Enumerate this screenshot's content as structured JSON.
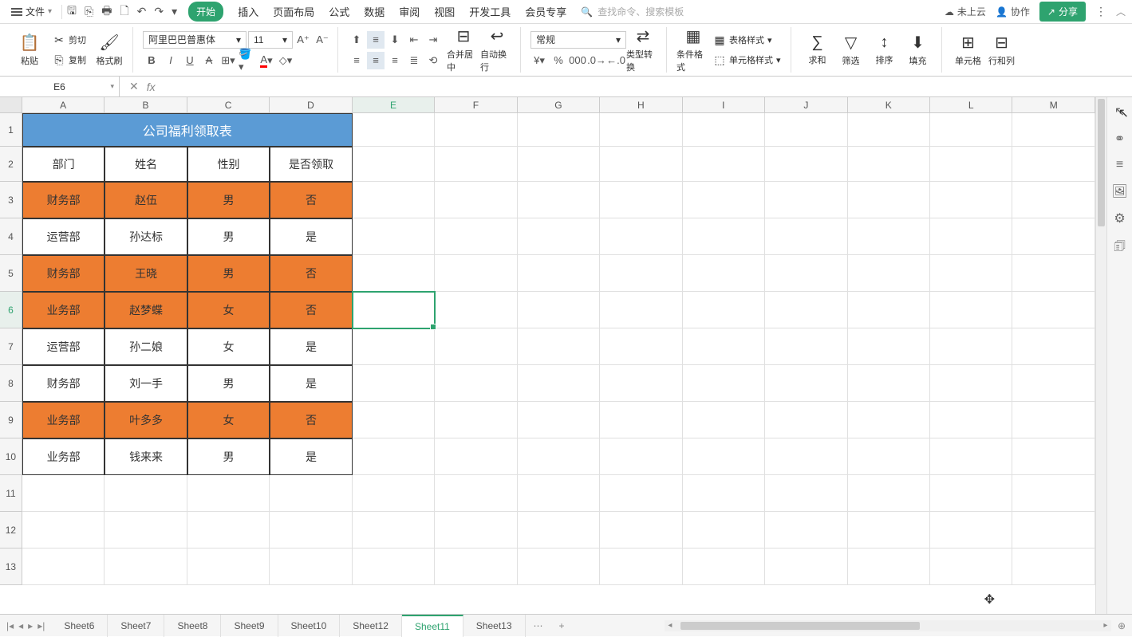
{
  "menubar": {
    "file_label": "文件",
    "tabs": [
      "开始",
      "插入",
      "页面布局",
      "公式",
      "数据",
      "审阅",
      "视图",
      "开发工具",
      "会员专享"
    ],
    "active_tab_index": 0,
    "search_placeholder": "查找命令、搜索模板",
    "cloud_label": "未上云",
    "collab_label": "协作",
    "share_label": "分享"
  },
  "ribbon": {
    "paste_label": "粘贴",
    "cut_label": "剪切",
    "copy_label": "复制",
    "format_painter_label": "格式刷",
    "font_name": "阿里巴巴普惠体",
    "font_size": "11",
    "merge_center_label": "合并居中",
    "wrap_text_label": "自动换行",
    "number_format": "常规",
    "type_convert_label": "类型转换",
    "cond_fmt_label": "条件格式",
    "table_style_label": "表格样式",
    "cell_style_label": "单元格样式",
    "sum_label": "求和",
    "filter_label": "筛选",
    "sort_label": "排序",
    "fill_label": "填充",
    "cell_label": "单元格",
    "rowcol_label": "行和列"
  },
  "namebox": {
    "value": "E6"
  },
  "fx_value": "",
  "col_letters": [
    "A",
    "B",
    "C",
    "D",
    "E",
    "F",
    "G",
    "H",
    "I",
    "J",
    "K",
    "L",
    "M"
  ],
  "row_heights": {
    "title": 42,
    "header": 44,
    "data": 46,
    "empty": 46
  },
  "active_cell": {
    "row": 6,
    "col": "E"
  },
  "chart_data": {
    "type": "table",
    "title": "公司福利领取表",
    "headers": [
      "部门",
      "姓名",
      "性别",
      "是否领取"
    ],
    "rows": [
      {
        "dept": "财务部",
        "name": "赵伍",
        "gender": "男",
        "received": "否",
        "highlight": true
      },
      {
        "dept": "运营部",
        "name": "孙达标",
        "gender": "男",
        "received": "是",
        "highlight": false
      },
      {
        "dept": "财务部",
        "name": "王晓",
        "gender": "男",
        "received": "否",
        "highlight": true
      },
      {
        "dept": "业务部",
        "name": "赵梦蝶",
        "gender": "女",
        "received": "否",
        "highlight": true
      },
      {
        "dept": "运营部",
        "name": "孙二娘",
        "gender": "女",
        "received": "是",
        "highlight": false
      },
      {
        "dept": "财务部",
        "name": "刘一手",
        "gender": "男",
        "received": "是",
        "highlight": false
      },
      {
        "dept": "业务部",
        "name": "叶多多",
        "gender": "女",
        "received": "否",
        "highlight": true
      },
      {
        "dept": "业务部",
        "name": "钱来来",
        "gender": "男",
        "received": "是",
        "highlight": false
      }
    ]
  },
  "sheet_tabs": [
    "Sheet6",
    "Sheet7",
    "Sheet8",
    "Sheet9",
    "Sheet10",
    "Sheet12",
    "Sheet11",
    "Sheet13"
  ],
  "active_sheet": "Sheet11",
  "colors": {
    "accent": "#2ea36f",
    "title_bg": "#5b9bd5",
    "highlight_bg": "#ed7d31"
  }
}
